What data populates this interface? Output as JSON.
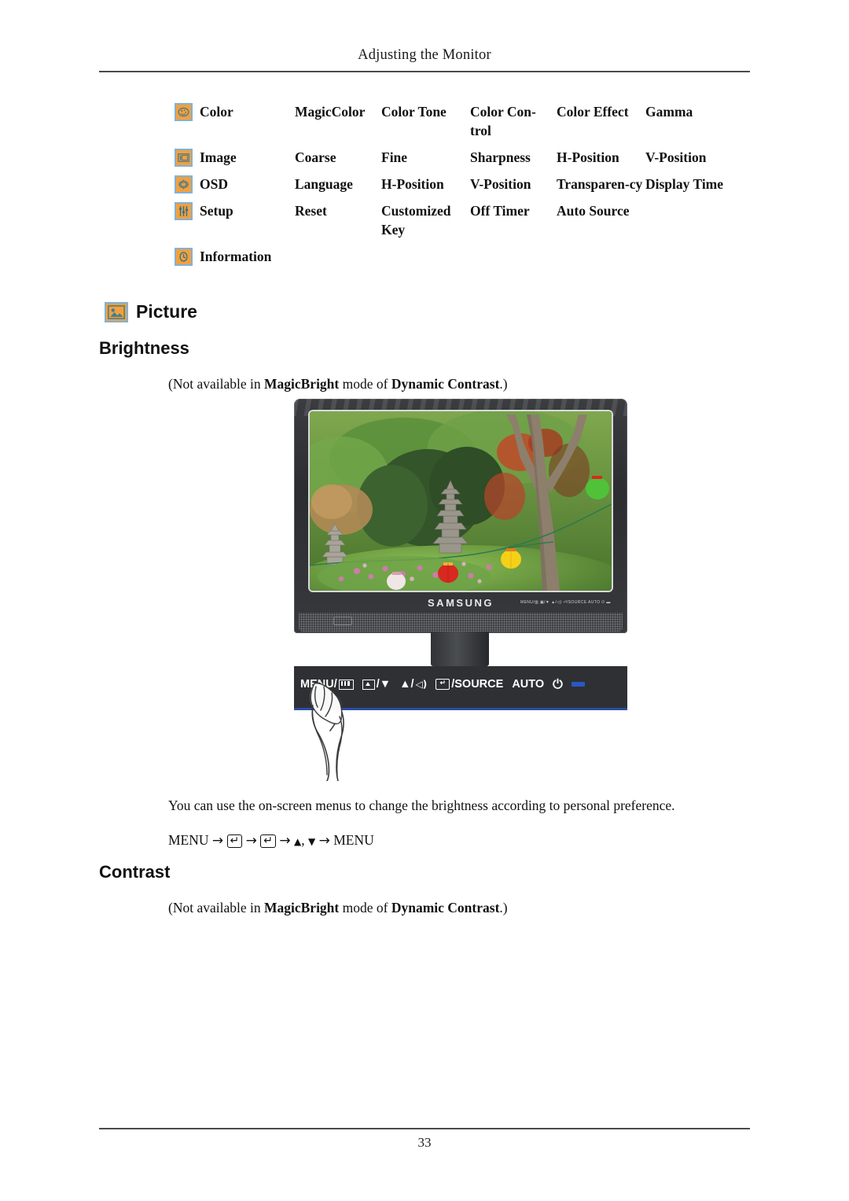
{
  "header": {
    "title": "Adjusting the Monitor"
  },
  "footer": {
    "page_number": "33"
  },
  "menu_map": {
    "rows": [
      {
        "icon": "color-palette-icon",
        "category": "Color",
        "items": [
          "MagicColor",
          "Color Tone",
          "Color Con-trol",
          "Color Effect",
          "Gamma"
        ]
      },
      {
        "icon": "image-frame-icon",
        "category": "Image",
        "items": [
          "Coarse",
          "Fine",
          "Sharpness",
          "H-Position",
          "V-Position"
        ]
      },
      {
        "icon": "osd-grid-icon",
        "category": "OSD",
        "items": [
          "Language",
          "H-Position",
          "V-Position",
          "Transparen-cy",
          "Display Time"
        ]
      },
      {
        "icon": "setup-sliders-icon",
        "category": "Setup",
        "items": [
          "Reset",
          "Customized Key",
          "Off Timer",
          "Auto Source",
          ""
        ]
      },
      {
        "icon": "information-clock-icon",
        "category": "Information",
        "items": [
          "",
          "",
          "",
          "",
          ""
        ]
      }
    ]
  },
  "sections": {
    "picture": {
      "icon": "picture-icon",
      "heading": "Picture"
    },
    "brightness": {
      "heading": "Brightness",
      "note_prefix": "(Not available in ",
      "note_bold1": "MagicBright",
      "note_mid": "  mode of ",
      "note_bold2": "Dynamic Contrast",
      "note_suffix": ".)",
      "description": "You can use the on-screen menus to change the brightness according to personal preference.",
      "nav": {
        "start": "MENU",
        "enter_key": "↵",
        "up": "▲",
        "down": "▼",
        "comma": ",",
        "arrow": "→",
        "end": "MENU"
      }
    },
    "contrast": {
      "heading": "Contrast",
      "note_prefix": "(Not available in ",
      "note_bold1": "MagicBright",
      "note_mid": " mode of ",
      "note_bold2": "Dynamic Contrast",
      "note_suffix": ".)"
    }
  },
  "figure": {
    "alt": "samsung-lcd-monitor-front-view",
    "brand": "SAMSUNG",
    "bezel_key_strip": "MENU/▥  ▣/▼  ▲/◁)  ⏎/SOURCE  AUTO  ⏻  ▬",
    "controls": [
      {
        "name": "menu-button",
        "label": "MENU/",
        "glyph": "osd-bars-icon"
      },
      {
        "name": "down-brightness-button",
        "label": "/▼",
        "glyph": "brightness-icon"
      },
      {
        "name": "up-volume-button",
        "label": "▲/",
        "glyph": "speaker-icon"
      },
      {
        "name": "source-enter-button",
        "label": "/SOURCE",
        "glyph": "enter-icon"
      },
      {
        "name": "auto-button",
        "label": "AUTO",
        "glyph": ""
      },
      {
        "name": "power-button",
        "label": "",
        "glyph": "power-icon"
      },
      {
        "name": "power-led",
        "label": "",
        "glyph": "led-indicator"
      }
    ],
    "screen_content": "garden-scene-with-stone-pagoda-and-lanterns"
  },
  "colors": {
    "icon_fill": "#f2a03c",
    "icon_border": "#7fb2d9",
    "rule": "#4a4a4a",
    "bezel": "#2e3034",
    "led_blue": "#2b56c4"
  }
}
